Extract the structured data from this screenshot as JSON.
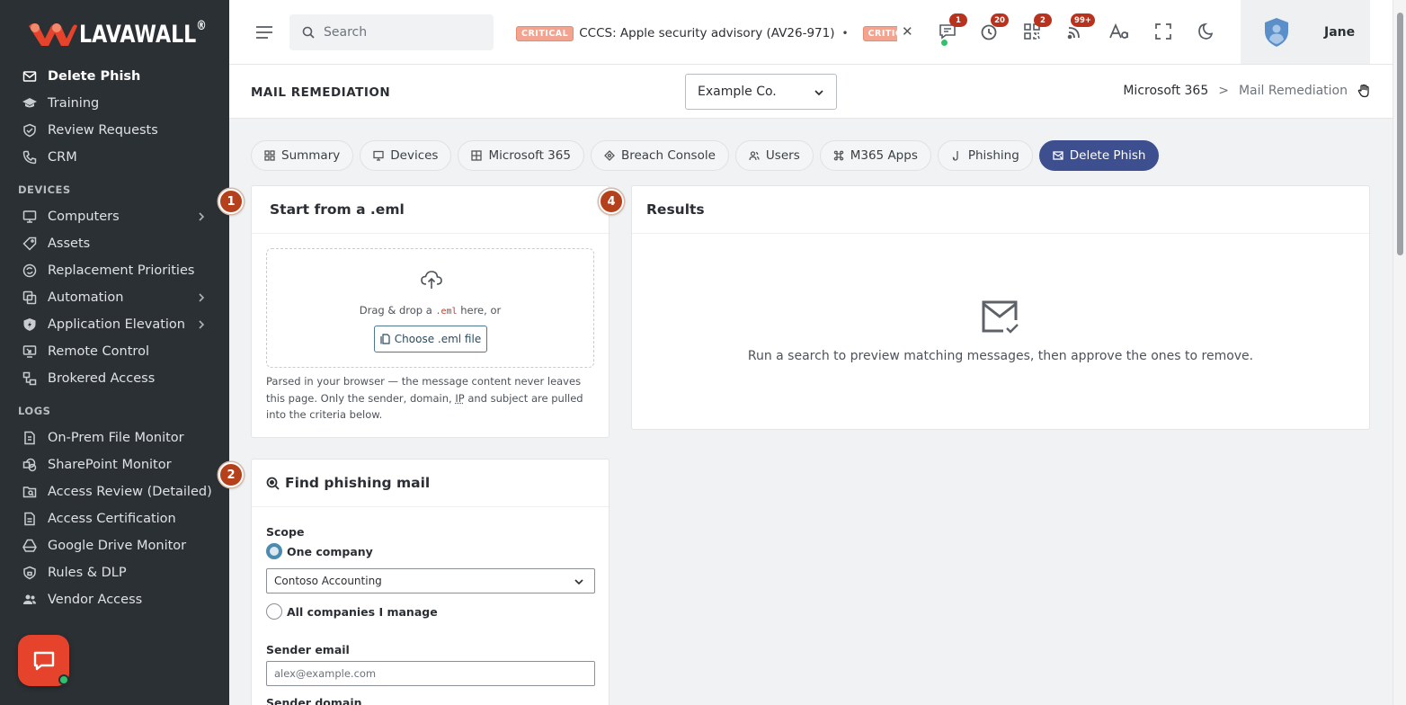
{
  "sidebar": {
    "logo_text": "LAVAWALL",
    "logo_reg": "®",
    "items_top": [
      {
        "label": "Delete Phish",
        "icon": "mail-check-icon",
        "active": true
      },
      {
        "label": "Training",
        "icon": "graduation-cap-icon"
      },
      {
        "label": "Review Requests",
        "icon": "shield-check-icon"
      },
      {
        "label": "CRM",
        "icon": "phone-icon"
      }
    ],
    "section_devices": "DEVICES",
    "items_devices": [
      {
        "label": "Computers",
        "icon": "monitor-icon",
        "expandable": true
      },
      {
        "label": "Assets",
        "icon": "tag-icon"
      },
      {
        "label": "Replacement Priorities",
        "icon": "refresh-circle-icon"
      },
      {
        "label": "Automation",
        "icon": "copy-gear-icon",
        "expandable": true
      },
      {
        "label": "Application Elevation",
        "icon": "shield-bolt-icon",
        "expandable": true
      },
      {
        "label": "Remote Control",
        "icon": "remote-desktop-icon"
      },
      {
        "label": "Brokered Access",
        "icon": "network-icon"
      }
    ],
    "section_logs": "LOGS",
    "items_logs": [
      {
        "label": "On-Prem File Monitor",
        "icon": "file-server-icon"
      },
      {
        "label": "SharePoint Monitor",
        "icon": "sharepoint-icon"
      },
      {
        "label": "Access Review (Detailed)",
        "icon": "folder-search-icon"
      },
      {
        "label": "Access Certification",
        "icon": "document-icon"
      },
      {
        "label": "Google Drive Monitor",
        "icon": "drive-icon"
      },
      {
        "label": "Rules & DLP",
        "icon": "shield-lock-icon"
      },
      {
        "label": "Vendor Access",
        "icon": "users-icon"
      }
    ]
  },
  "topbar": {
    "search_placeholder": "Search",
    "ticker_badge": "CRITICAL",
    "ticker_text": "CCCS: Apple security advisory (AV26-971)",
    "ticker_sep": "•",
    "ticker_badge_2": "CRITICAL",
    "ticker_close": "✕",
    "badges": {
      "messages": "1",
      "timer": "20",
      "qr": "2",
      "feed": "99+"
    },
    "user_name": "Jane"
  },
  "pagehead": {
    "title": "MAIL REMEDIATION",
    "company": "Example Co.",
    "crumb_1": "Microsoft 365",
    "crumb_sep": ">",
    "crumb_2": "Mail Remediation"
  },
  "tabs": [
    {
      "label": "Summary",
      "icon": "grid-icon"
    },
    {
      "label": "Devices",
      "icon": "monitor-icon"
    },
    {
      "label": "Microsoft 365",
      "icon": "windows-icon"
    },
    {
      "label": "Breach Console",
      "icon": "crosshair-icon"
    },
    {
      "label": "Users",
      "icon": "users-icon"
    },
    {
      "label": "M365 Apps",
      "icon": "command-icon"
    },
    {
      "label": "Phishing",
      "icon": "hook-icon"
    },
    {
      "label": "Delete Phish",
      "icon": "mail-x-icon",
      "active": true
    }
  ],
  "eml_card": {
    "step": "1",
    "title": "Start from a .eml",
    "drop_before": "Drag & drop a ",
    "drop_code": ".eml",
    "drop_after": " here, or",
    "choose_label": "Choose .eml file",
    "note_1": "Parsed in your browser — the message content never leaves this page. Only the sender, domain, ",
    "note_ip": "IP",
    "note_2": " and subject are pulled into the criteria below."
  },
  "results_card": {
    "step": "4",
    "title": "Results",
    "empty_text": "Run a search to preview matching messages, then approve the ones to remove."
  },
  "find_card": {
    "step": "2",
    "title": "Find phishing mail",
    "scope_label": "Scope",
    "option_one": "One company",
    "company_value": "Contoso Accounting",
    "option_all": "All companies I manage",
    "sender_email_label": "Sender email",
    "sender_email_placeholder": "alex@example.com",
    "sender_domain_label": "Sender domain"
  },
  "colors": {
    "accent": "#3d4f8f",
    "brand": "#e5432b",
    "step": "#b5401c",
    "sidebar": "#2b3034"
  }
}
